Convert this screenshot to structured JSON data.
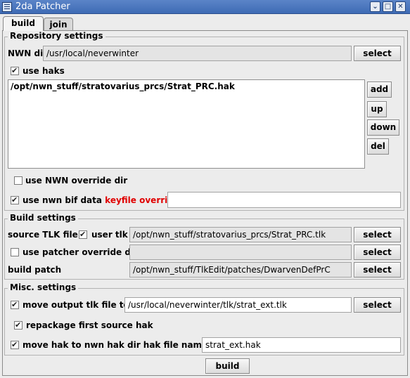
{
  "window": {
    "title": "2da Patcher"
  },
  "tabs": [
    {
      "label": "build"
    },
    {
      "label": "join"
    }
  ],
  "repository": {
    "title": "Repository settings",
    "nwn_dir_label": "NWN dir",
    "nwn_dir_value": "/usr/local/neverwinter",
    "select_label": "select",
    "use_haks_label": "use haks",
    "use_haks_checked": true,
    "hak_list": [
      "/opt/nwn_stuff/stratovarius_prcs/Strat_PRC.hak"
    ],
    "list_buttons": {
      "add": "add",
      "up": "up",
      "down": "down",
      "del": "del"
    },
    "use_override_label": "use NWN override dir",
    "use_override_checked": false,
    "use_bif_label": "use nwn bif data",
    "keyfile_override_label": "keyfile override",
    "use_bif_checked": true,
    "keyfile_value": ""
  },
  "build": {
    "title": "Build settings",
    "source_tlk_label": "source TLK file",
    "user_tlk_label": "user tlk",
    "user_tlk_checked": true,
    "source_tlk_value": "/opt/nwn_stuff/stratovarius_prcs/Strat_PRC.tlk",
    "patcher_override_label": "use patcher override dir",
    "patcher_override_checked": false,
    "patcher_override_value": "",
    "build_patch_label": "build patch",
    "build_patch_value": "/opt/nwn_stuff/TlkEdit/patches/DwarvenDefPrC",
    "select_label": "select"
  },
  "misc": {
    "title": "Misc. settings",
    "move_tlk_label": "move output tlk file to",
    "move_tlk_checked": true,
    "move_tlk_value": "/usr/local/neverwinter/tlk/strat_ext.tlk",
    "select_label": "select",
    "repackage_label": "repackage first source hak",
    "repackage_checked": true,
    "move_hak_label": "move hak to nwn hak dir hak file name :",
    "move_hak_checked": true,
    "hak_name_value": "strat_ext.hak"
  },
  "build_button": {
    "label": "build"
  }
}
